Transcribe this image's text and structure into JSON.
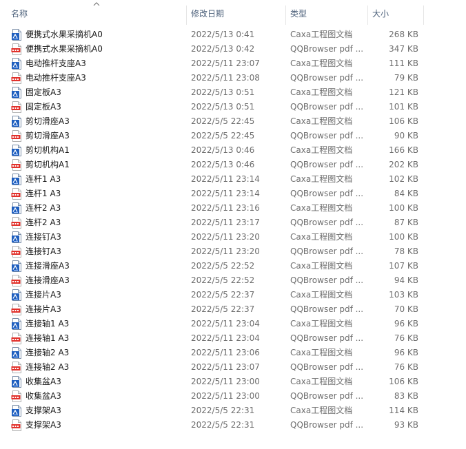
{
  "columns": {
    "name": "名称",
    "date": "修改日期",
    "type": "类型",
    "size": "大小"
  },
  "sort": {
    "column": "name",
    "direction": "ascending"
  },
  "icons": {
    "caxa": "caxa-file-icon",
    "pdf": "pdf-file-icon"
  },
  "files": [
    {
      "name": "便携式水果采摘机A0",
      "date": "2022/5/13 0:41",
      "type": "Caxa工程图文档",
      "size": "268 KB",
      "kind": "caxa"
    },
    {
      "name": "便携式水果采摘机A0",
      "date": "2022/5/13 0:42",
      "type": "QQBrowser pdf ...",
      "size": "347 KB",
      "kind": "pdf"
    },
    {
      "name": "电动推杆支座A3",
      "date": "2022/5/11 23:07",
      "type": "Caxa工程图文档",
      "size": "111 KB",
      "kind": "caxa"
    },
    {
      "name": "电动推杆支座A3",
      "date": "2022/5/11 23:08",
      "type": "QQBrowser pdf ...",
      "size": "79 KB",
      "kind": "pdf"
    },
    {
      "name": "固定板A3",
      "date": "2022/5/13 0:51",
      "type": "Caxa工程图文档",
      "size": "121 KB",
      "kind": "caxa"
    },
    {
      "name": "固定板A3",
      "date": "2022/5/13 0:51",
      "type": "QQBrowser pdf ...",
      "size": "101 KB",
      "kind": "pdf"
    },
    {
      "name": "剪切滑座A3",
      "date": "2022/5/5 22:45",
      "type": "Caxa工程图文档",
      "size": "106 KB",
      "kind": "caxa"
    },
    {
      "name": "剪切滑座A3",
      "date": "2022/5/5 22:45",
      "type": "QQBrowser pdf ...",
      "size": "90 KB",
      "kind": "pdf"
    },
    {
      "name": "剪切机构A1",
      "date": "2022/5/13 0:46",
      "type": "Caxa工程图文档",
      "size": "166 KB",
      "kind": "caxa"
    },
    {
      "name": "剪切机构A1",
      "date": "2022/5/13 0:46",
      "type": "QQBrowser pdf ...",
      "size": "202 KB",
      "kind": "pdf"
    },
    {
      "name": "连杆1 A3",
      "date": "2022/5/11 23:14",
      "type": "Caxa工程图文档",
      "size": "102 KB",
      "kind": "caxa"
    },
    {
      "name": "连杆1 A3",
      "date": "2022/5/11 23:14",
      "type": "QQBrowser pdf ...",
      "size": "84 KB",
      "kind": "pdf"
    },
    {
      "name": "连杆2 A3",
      "date": "2022/5/11 23:16",
      "type": "Caxa工程图文档",
      "size": "100 KB",
      "kind": "caxa"
    },
    {
      "name": "连杆2 A3",
      "date": "2022/5/11 23:17",
      "type": "QQBrowser pdf ...",
      "size": "87 KB",
      "kind": "pdf"
    },
    {
      "name": "连接钉A3",
      "date": "2022/5/11 23:20",
      "type": "Caxa工程图文档",
      "size": "100 KB",
      "kind": "caxa"
    },
    {
      "name": "连接钉A3",
      "date": "2022/5/11 23:20",
      "type": "QQBrowser pdf ...",
      "size": "78 KB",
      "kind": "pdf"
    },
    {
      "name": "连接滑座A3",
      "date": "2022/5/5 22:52",
      "type": "Caxa工程图文档",
      "size": "107 KB",
      "kind": "caxa"
    },
    {
      "name": "连接滑座A3",
      "date": "2022/5/5 22:52",
      "type": "QQBrowser pdf ...",
      "size": "94 KB",
      "kind": "pdf"
    },
    {
      "name": "连接片A3",
      "date": "2022/5/5 22:37",
      "type": "Caxa工程图文档",
      "size": "103 KB",
      "kind": "caxa"
    },
    {
      "name": "连接片A3",
      "date": "2022/5/5 22:37",
      "type": "QQBrowser pdf ...",
      "size": "70 KB",
      "kind": "pdf"
    },
    {
      "name": "连接轴1 A3",
      "date": "2022/5/11 23:04",
      "type": "Caxa工程图文档",
      "size": "96 KB",
      "kind": "caxa"
    },
    {
      "name": "连接轴1 A3",
      "date": "2022/5/11 23:04",
      "type": "QQBrowser pdf ...",
      "size": "76 KB",
      "kind": "pdf"
    },
    {
      "name": "连接轴2 A3",
      "date": "2022/5/11 23:06",
      "type": "Caxa工程图文档",
      "size": "96 KB",
      "kind": "caxa"
    },
    {
      "name": "连接轴2 A3",
      "date": "2022/5/11 23:07",
      "type": "QQBrowser pdf ...",
      "size": "76 KB",
      "kind": "pdf"
    },
    {
      "name": "收集盆A3",
      "date": "2022/5/11 23:00",
      "type": "Caxa工程图文档",
      "size": "106 KB",
      "kind": "caxa"
    },
    {
      "name": "收集盆A3",
      "date": "2022/5/11 23:00",
      "type": "QQBrowser pdf ...",
      "size": "83 KB",
      "kind": "pdf"
    },
    {
      "name": "支撑架A3",
      "date": "2022/5/5 22:31",
      "type": "Caxa工程图文档",
      "size": "114 KB",
      "kind": "caxa"
    },
    {
      "name": "支撑架A3",
      "date": "2022/5/5 22:31",
      "type": "QQBrowser pdf ...",
      "size": "93 KB",
      "kind": "pdf"
    }
  ]
}
